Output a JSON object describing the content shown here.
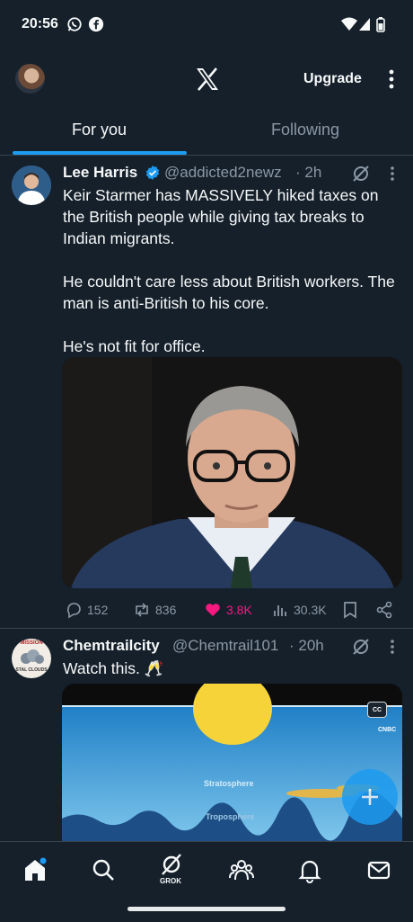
{
  "status_bar": {
    "time": "20:56",
    "icons": [
      "whatsapp-icon",
      "facebook-icon",
      "wifi-icon",
      "signal-icon",
      "battery-icon"
    ]
  },
  "header": {
    "logo": "x-logo",
    "upgrade_label": "Upgrade"
  },
  "tabs": [
    {
      "label": "For you",
      "selected": true
    },
    {
      "label": "Following",
      "selected": false
    }
  ],
  "tweets": [
    {
      "name": "Lee Harris",
      "verified": true,
      "handle": "@addicted2newz",
      "time": "· 2h",
      "text": "Keir Starmer has MASSIVELY hiked taxes on the British people while giving tax breaks to Indian migrants.\n\nHe couldn't care less about British workers. The man is anti-British to his core.\n\nHe's not fit for office.",
      "stats": {
        "replies": "152",
        "reposts": "836",
        "likes": "3.8K",
        "views": "30.3K"
      }
    },
    {
      "name": "Chemtrailcity",
      "handle": "@Chemtrail101",
      "time": "· 20h",
      "text": "Watch this. 🥂",
      "avatar_text": {
        "top": "MISSION",
        "bottom": "STAL CLOUDS"
      },
      "video_labels": {
        "stratosphere": "Stratosphere",
        "troposphere": "Troposphere",
        "cc": "CC",
        "network": "CNBC"
      }
    }
  ],
  "colors": {
    "background": "#15202b",
    "accent": "#1d9bf0",
    "like": "#f91880",
    "muted": "#8b98a5"
  },
  "bottom_nav": {
    "grok_label": "GROK",
    "items": [
      "home-icon",
      "search-icon",
      "grok-icon",
      "communities-icon",
      "notifications-icon",
      "messages-icon"
    ]
  }
}
